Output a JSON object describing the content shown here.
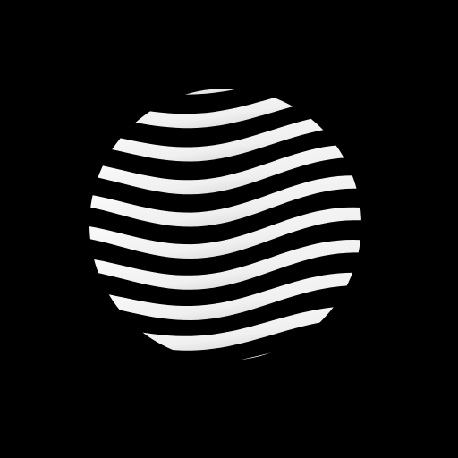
{
  "icon": {
    "name": "wave-sphere-logo-icon",
    "stripe_count": 10
  },
  "colors": {
    "background": "#000000",
    "stripe_light": "#ffffff",
    "stripe_shade": "#c7c7c7"
  }
}
